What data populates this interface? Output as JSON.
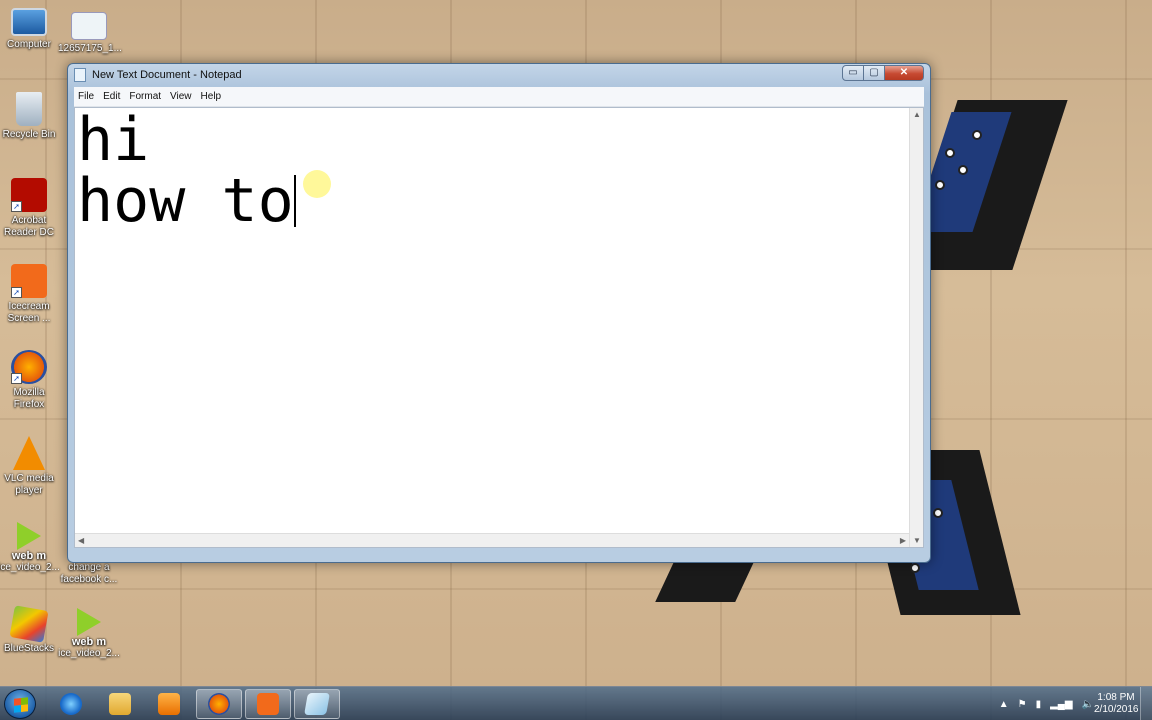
{
  "desktop": {
    "icons": [
      {
        "label": "Computer",
        "icon": "computer-icon"
      },
      {
        "label": "12657175_1...",
        "icon": "image-file-icon"
      },
      {
        "label": "Recycle Bin",
        "icon": "recycle-bin-icon"
      },
      {
        "label": "Acrobat Reader DC",
        "icon": "acrobat-icon"
      },
      {
        "label": "Icecream Screen ...",
        "icon": "icecream-icon"
      },
      {
        "label": "Mozilla Firefox",
        "icon": "firefox-icon"
      },
      {
        "label": "VLC media player",
        "icon": "vlc-icon"
      },
      {
        "label": "ice_video_2...",
        "icon": "webm-icon"
      },
      {
        "label": "change a facebook c...",
        "icon": "file-icon"
      },
      {
        "label": "BlueStacks",
        "icon": "bluestacks-icon"
      },
      {
        "label": "ice_video_2...",
        "icon": "webm-icon"
      }
    ],
    "webm_label": "web m"
  },
  "notepad": {
    "title": "New Text Document - Notepad",
    "menu": [
      "File",
      "Edit",
      "Format",
      "View",
      "Help"
    ],
    "lines": [
      "hi",
      "how to"
    ],
    "buttons": {
      "minimize": "▭",
      "maximize": "▢",
      "close": "✕"
    }
  },
  "taskbar": {
    "apps": [
      "start-icon",
      "internet-explorer-icon",
      "file-explorer-icon",
      "media-player-icon",
      "firefox-icon",
      "icecream-icon",
      "notepad-icon"
    ],
    "time": "1:08 PM",
    "date": "2/10/2016"
  },
  "colors": {
    "taskbar": "#3a5878",
    "close_button": "#c74a32",
    "wallpaper": "#d6bc98"
  }
}
